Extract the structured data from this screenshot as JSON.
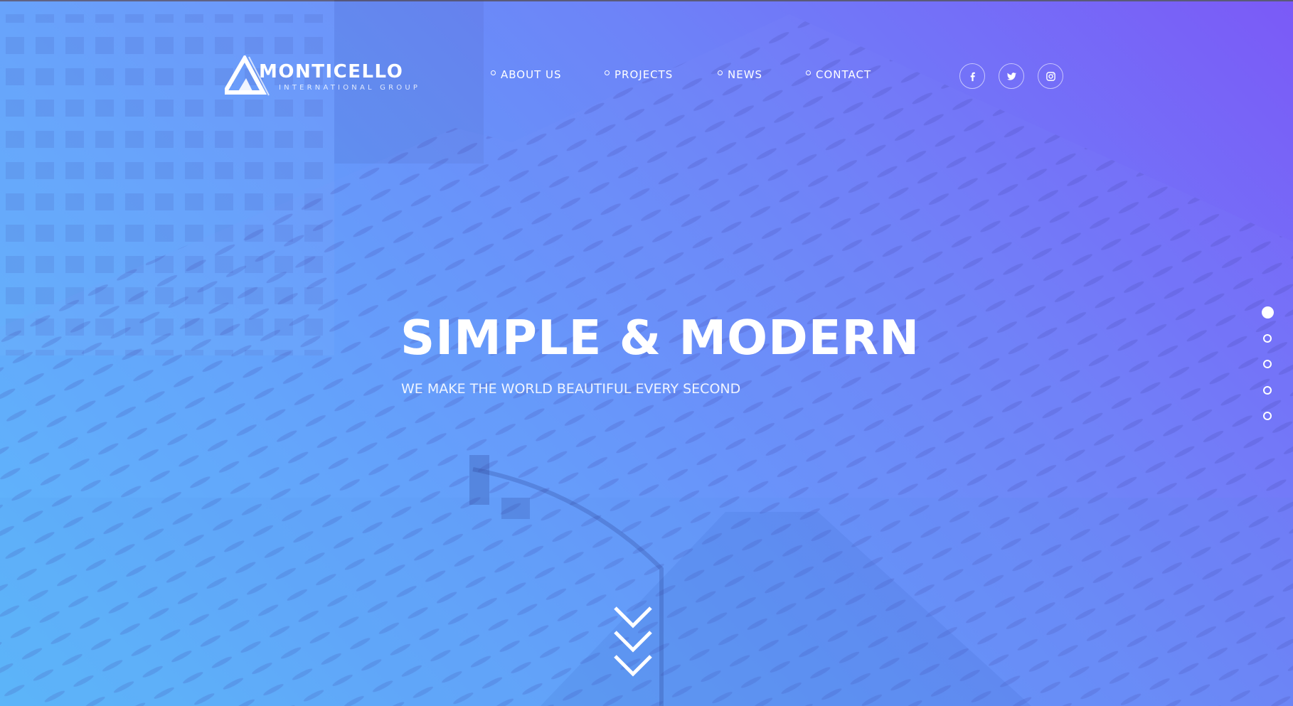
{
  "brand": {
    "name": "MONTICELLO",
    "tagline": "INTERNATIONAL GROUP",
    "logo_icon": "triangle-logo-icon"
  },
  "nav": {
    "items": [
      {
        "label": "ABOUT US",
        "icon": "circle-bullet-icon"
      },
      {
        "label": "PROJECTS",
        "icon": "circle-bullet-icon"
      },
      {
        "label": "NEWS",
        "icon": "circle-bullet-icon"
      },
      {
        "label": "CONTACT",
        "icon": "circle-bullet-icon"
      }
    ]
  },
  "social": [
    {
      "icon": "facebook-icon"
    },
    {
      "icon": "twitter-icon"
    },
    {
      "icon": "instagram-icon"
    }
  ],
  "hero": {
    "title": "SIMPLE & MODERN",
    "subtitle": "WE MAKE THE WORLD BEAUTIFUL EVERY SECOND"
  },
  "slider": {
    "total": 5,
    "active_index": 0
  },
  "scroll_indicator": {
    "icon": "chevrons-down-icon"
  },
  "colors": {
    "gradient_top_right": "#7b5af7",
    "gradient_bottom_left": "#5bbcfb",
    "text": "#ffffff"
  }
}
